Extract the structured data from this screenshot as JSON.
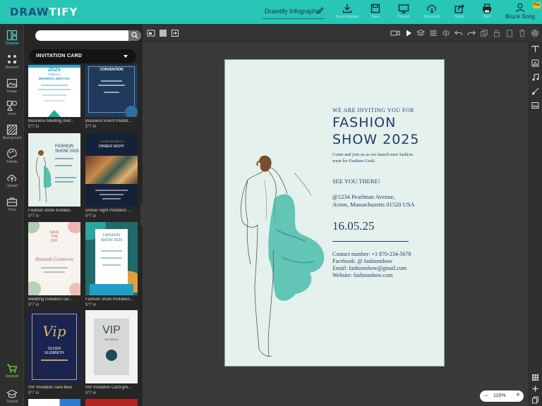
{
  "app": {
    "logo_prefix": "DRAW",
    "logo_suffix": "TIFY",
    "doc_title": "Drawtify Infographic",
    "user_name": "Bruce Song",
    "pro_badge": "Pro"
  },
  "toolbar": {
    "buttons": [
      {
        "label": "Save template",
        "icon": "download-icon"
      },
      {
        "label": "Save",
        "icon": "save-icon"
      },
      {
        "label": "Present",
        "icon": "monitor-icon"
      },
      {
        "label": "Download",
        "icon": "cloud-download-icon"
      },
      {
        "label": "Share",
        "icon": "share-icon"
      },
      {
        "label": "Print",
        "icon": "printer-icon"
      }
    ]
  },
  "leftrail": {
    "items": [
      {
        "label": "Template",
        "icon": "template-icon",
        "active": true
      },
      {
        "label": "Element",
        "icon": "element-icon"
      },
      {
        "label": "Image",
        "icon": "image-icon"
      },
      {
        "label": "Icons",
        "icon": "icons-icon"
      },
      {
        "label": "Background",
        "icon": "background-icon"
      },
      {
        "label": "Palette",
        "icon": "palette-icon"
      },
      {
        "label": "Upload",
        "icon": "upload-icon"
      },
      {
        "label": "Tools",
        "icon": "tools-icon"
      }
    ],
    "upgrade": "Upgrade",
    "tutorial": "Tutorial"
  },
  "panel": {
    "search_placeholder": "",
    "category": "INVITATION CARD",
    "templates": [
      {
        "name": "Business Meeting Invit...",
        "size": "5*7 in"
      },
      {
        "name": "Business Event Invitati...",
        "size": "5*7 in"
      },
      {
        "name": "Fashion show invitatio...",
        "size": "5*7 in"
      },
      {
        "name": "Dinner night Invitation ...",
        "size": "5*7 in"
      },
      {
        "name": "wedding invitation car...",
        "size": "5*7 in"
      },
      {
        "name": "Fashion show Invitation...",
        "size": "5*7 in"
      },
      {
        "name": "VIP Invitation card-blue",
        "size": "5*7 in"
      },
      {
        "name": "VIP Invitation Card-gre...",
        "size": "5*7 in"
      }
    ],
    "thumb_text": {
      "t1_year": "2025",
      "t1_l1": "ANNUAL",
      "t1_l2": "MEMBERS MEETING",
      "t2": "CONVENTION",
      "t3_l1": "FASHION",
      "t3_l2": "SHOW 2025",
      "t4_l1": "YOU'RE INVITED TO",
      "t4_l2": "DINNER NIGHT",
      "t5_l1": "SAVE",
      "t5_l2": "THE",
      "t5_l3": "DAY",
      "t5_names": "Hannah  Cameron",
      "t6_l1": "FASHION",
      "t6_l2": "SHOW 2025",
      "t7_vip": "Vip",
      "t7_name1": "OLIVER",
      "t7_name2": "ELIZABETH",
      "t8_vip": "VIP",
      "t8_sub": "INVITATION"
    }
  },
  "canvas": {
    "zoom": "116%",
    "page": {
      "invite": "WE ARE INVITING YOU FOR",
      "title_l1": "FASHION",
      "title_l2": "SHOW 2025",
      "desc": "Come and join us as we launch new fashion wear for Fashion Geek.",
      "see": "SEE YOU THERE!",
      "addr_l1": "@1234  Pearlman Avenue,",
      "addr_l2": "Acton, Massachusetts 01520 USA",
      "date": "16.05.25",
      "contact": [
        "Contact number: +1 870-234-5678",
        "Facebook: @ fashionshow",
        "Email:  fashionshow@gmail.com",
        "Website: fashionshow.com"
      ]
    }
  },
  "colors": {
    "brand": "#27c6b6",
    "page_bg": "#e4f1ec",
    "navy": "#1d3d6e",
    "teal": "#3fb8a6"
  }
}
